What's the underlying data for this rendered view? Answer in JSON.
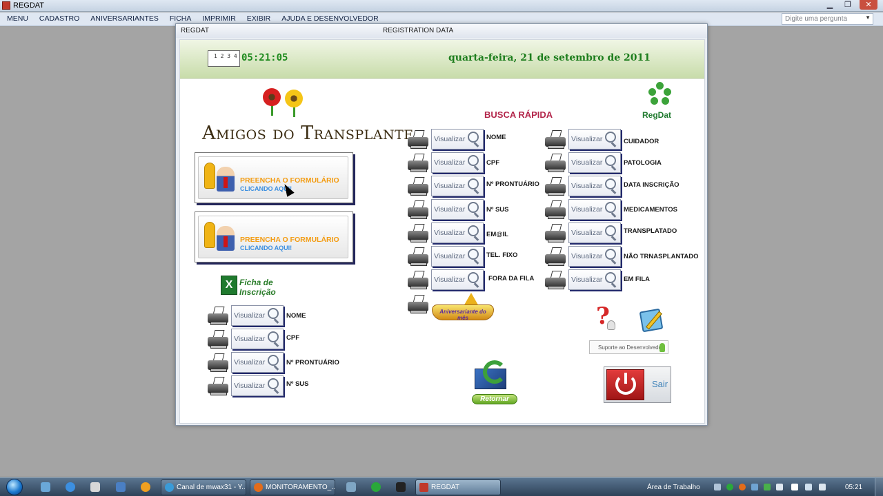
{
  "window": {
    "title": "REGDAT"
  },
  "menubar": {
    "items": [
      "MENU",
      "CADASTRO",
      "ANIVERSARIANTES",
      "FICHA",
      "IMPRIMIR",
      "EXIBIR",
      "AJUDA E DESENVOLVEDOR"
    ],
    "question_placeholder": "Digite uma pergunta"
  },
  "dialog": {
    "caption_left": "REGDAT",
    "caption_center": "REGISTRATION  DATA"
  },
  "header": {
    "clock_time": "05:21:05",
    "clock_icon_text": "1 2 3 4",
    "date": "quarta-feira, 21 de setembro de 2011"
  },
  "brand": {
    "title": "Amigos do Transplante",
    "logo_text": "RegDat"
  },
  "form_buttons": [
    {
      "line1": "PREENCHA O FORMULÁRIO",
      "line2": "CLICANDO AQUI!"
    },
    {
      "line1": "PREENCHA O FORMULÁRIO",
      "line2": "CLICANDO AQUI!"
    }
  ],
  "ficha": {
    "title_line1": "Ficha de",
    "title_line2": "Inscrição",
    "icon_glyph": "X",
    "items": [
      {
        "button": "Visualizar",
        "label": "NOME"
      },
      {
        "button": "Visualizar",
        "label": "CPF"
      },
      {
        "button": "Visualizar",
        "label": "Nº PRONTUÁRIO"
      },
      {
        "button": "Visualizar",
        "label": "Nº SUS"
      }
    ]
  },
  "busca": {
    "title": "BUSCA RÁPIDA",
    "left": [
      {
        "button": "Visualizar",
        "label": "NOME"
      },
      {
        "button": "Visualizar",
        "label": "CPF"
      },
      {
        "button": "Visualizar",
        "label": "Nº PRONTUÁRIO"
      },
      {
        "button": "Visualizar",
        "label": "Nº SUS"
      },
      {
        "button": "Visualizar",
        "label": "EM@IL"
      },
      {
        "button": "Visualizar",
        "label": "TEL. FIXO"
      },
      {
        "button": "Visualizar",
        "label": "FORA DA FILA"
      }
    ],
    "right": [
      {
        "button": "Visualizar",
        "label": "CUIDADOR"
      },
      {
        "button": "Visualizar",
        "label": "PATOLOGIA"
      },
      {
        "button": "Visualizar",
        "label": "DATA INSCRIÇÃO"
      },
      {
        "button": "Visualizar",
        "label": "MEDICAMENTOS"
      },
      {
        "button": "Visualizar",
        "label": "TRANSPLATADO"
      },
      {
        "button": "Visualizar",
        "label": "NÃO TRNASPLANTADO"
      },
      {
        "button": "Visualizar",
        "label": "EM FILA"
      }
    ]
  },
  "aniversario": {
    "label": "Aniversariante do mês"
  },
  "suporte": {
    "label": "Suporte ao Desenvolvedor"
  },
  "retornar": {
    "label": "Retornar"
  },
  "sair": {
    "label": "Sair"
  },
  "taskbar": {
    "buttons": [
      {
        "label": "Canal de mwax31 - Y...",
        "color": "#3a9bd8"
      },
      {
        "label": "MONITORAMENTO_...",
        "color": "#e36c1a"
      },
      {
        "label": "REGDAT",
        "color": "#c0392b"
      }
    ],
    "area_label": "Área de Trabalho",
    "clock": "05:21"
  },
  "colors": {
    "accent_green": "#1d8a1d",
    "busca_title": "#b3264b",
    "button_shadow": "#22296c"
  }
}
